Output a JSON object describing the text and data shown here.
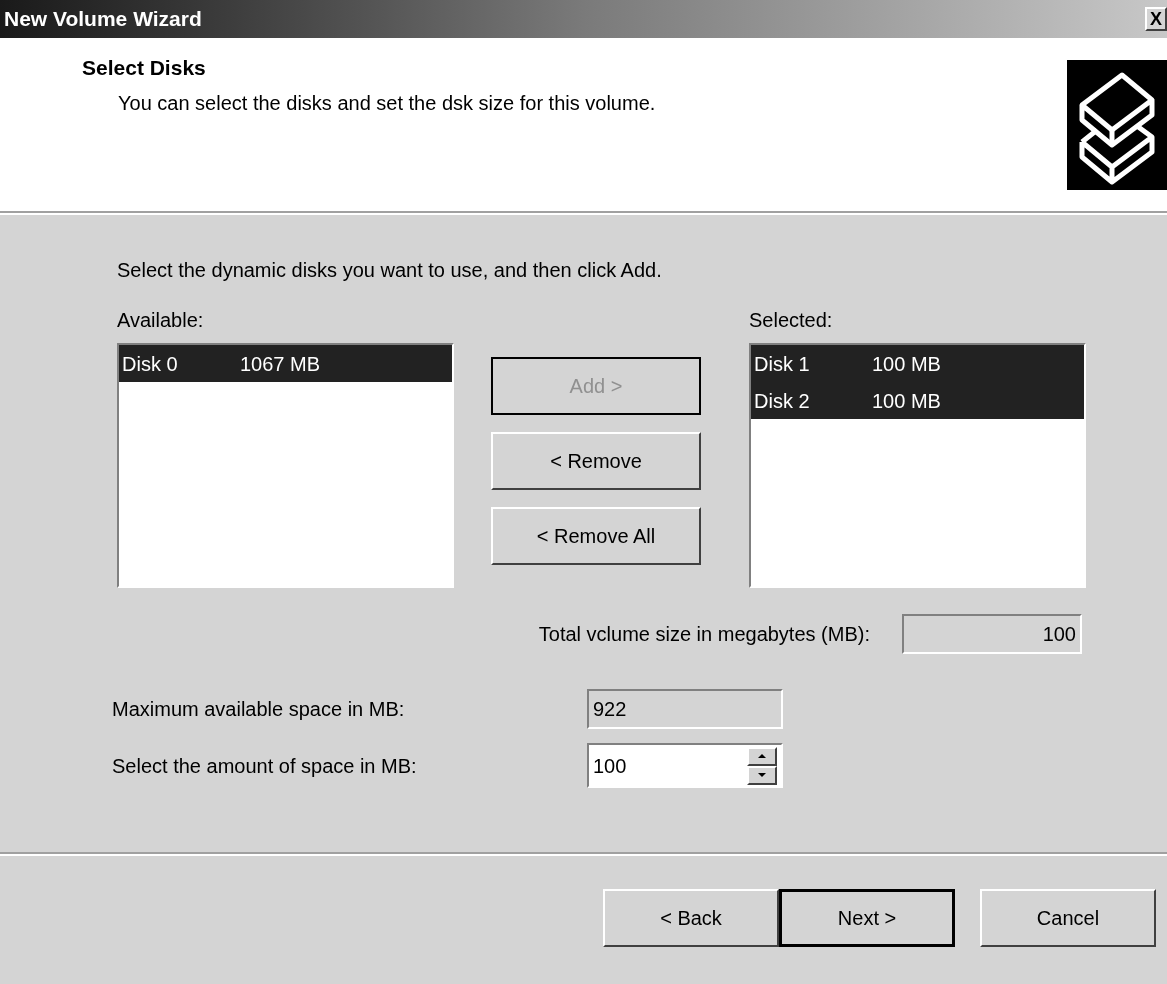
{
  "window": {
    "title": "New Volume Wizard",
    "close": "X"
  },
  "header": {
    "title": "Select Disks",
    "subtitle": "You can select the disks and set the dsk size for this volume."
  },
  "instruction": "Select the dynamic disks you want to use, and then click Add.",
  "available": {
    "label": "Available:",
    "items": [
      {
        "name": "Disk 0",
        "size": "1067 MB",
        "selected": true
      }
    ]
  },
  "transfer_buttons": [
    {
      "label": "Add >",
      "disabled": true
    },
    {
      "label": "< Remove",
      "disabled": false
    },
    {
      "label": "< Remove All",
      "disabled": false
    }
  ],
  "selected": {
    "label": "Selected:",
    "items": [
      {
        "name": "Disk 1",
        "size": "100 MB",
        "selected": true
      },
      {
        "name": "Disk 2",
        "size": "100 MB",
        "selected": true
      }
    ]
  },
  "total": {
    "label": "Total vclume size in megabytes (MB):",
    "value": "100"
  },
  "max_space": {
    "label": "Maximum available space in MB:",
    "value": "922"
  },
  "amount": {
    "label": "Select the amount of space in MB:",
    "value": "100"
  },
  "footer_buttons": [
    {
      "label": "< Back",
      "default": false
    },
    {
      "label": "Next >",
      "default": true
    },
    {
      "label": "Cancel",
      "default": false
    }
  ]
}
